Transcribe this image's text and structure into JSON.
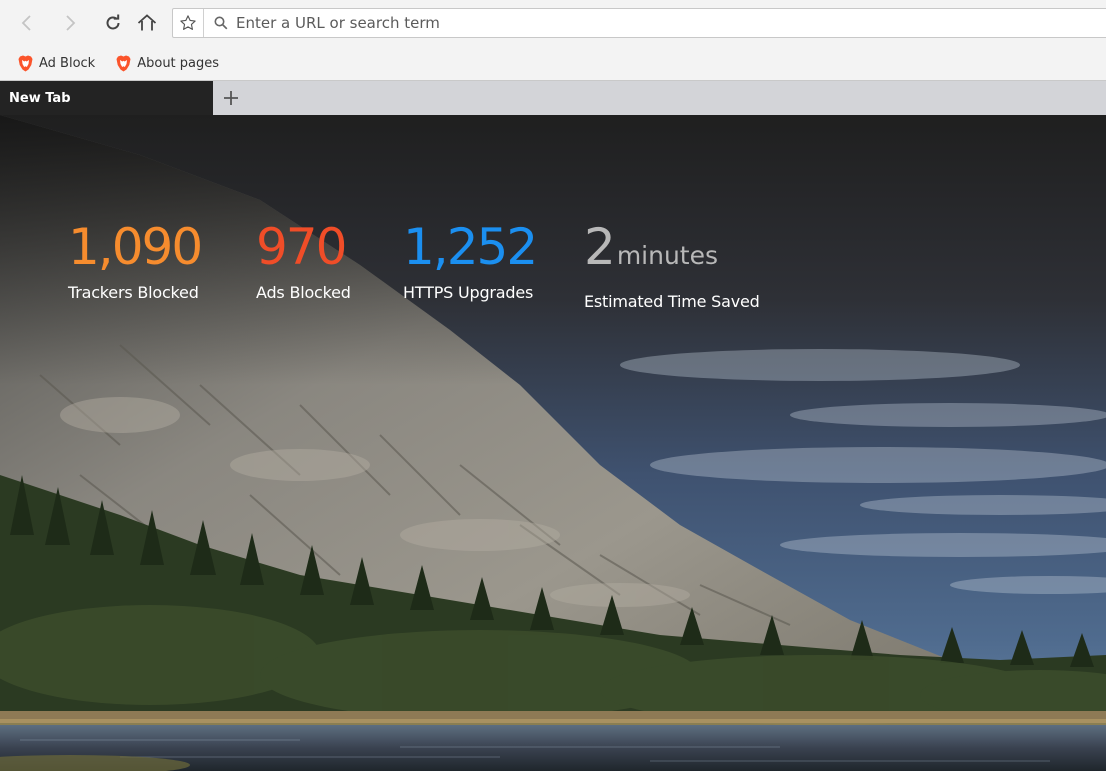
{
  "toolbar": {
    "search": {
      "placeholder": "Enter a URL or search term",
      "value": ""
    }
  },
  "bookmarks": [
    {
      "label": "Ad Block",
      "icon": "brave-lion-icon"
    },
    {
      "label": "About pages",
      "icon": "brave-lion-icon"
    }
  ],
  "tabs": [
    {
      "label": "New Tab",
      "active": true
    }
  ],
  "stats": {
    "trackers": {
      "value": "1,090",
      "label": "Trackers Blocked",
      "color": "#f68c2e"
    },
    "ads": {
      "value": "970",
      "label": "Ads Blocked",
      "color": "#f04d28"
    },
    "https": {
      "value": "1,252",
      "label": "HTTPS Upgrades",
      "color": "#1b8ff0"
    },
    "time": {
      "value": "2",
      "unit": "minutes",
      "label": "Estimated Time Saved",
      "color": "#b8b8b8"
    }
  },
  "colors": {
    "brand": "#fb542b",
    "toolbar_bg": "#f3f3f3",
    "tabstrip_bg": "#d3d4d8",
    "active_tab_bg": "#232323"
  }
}
